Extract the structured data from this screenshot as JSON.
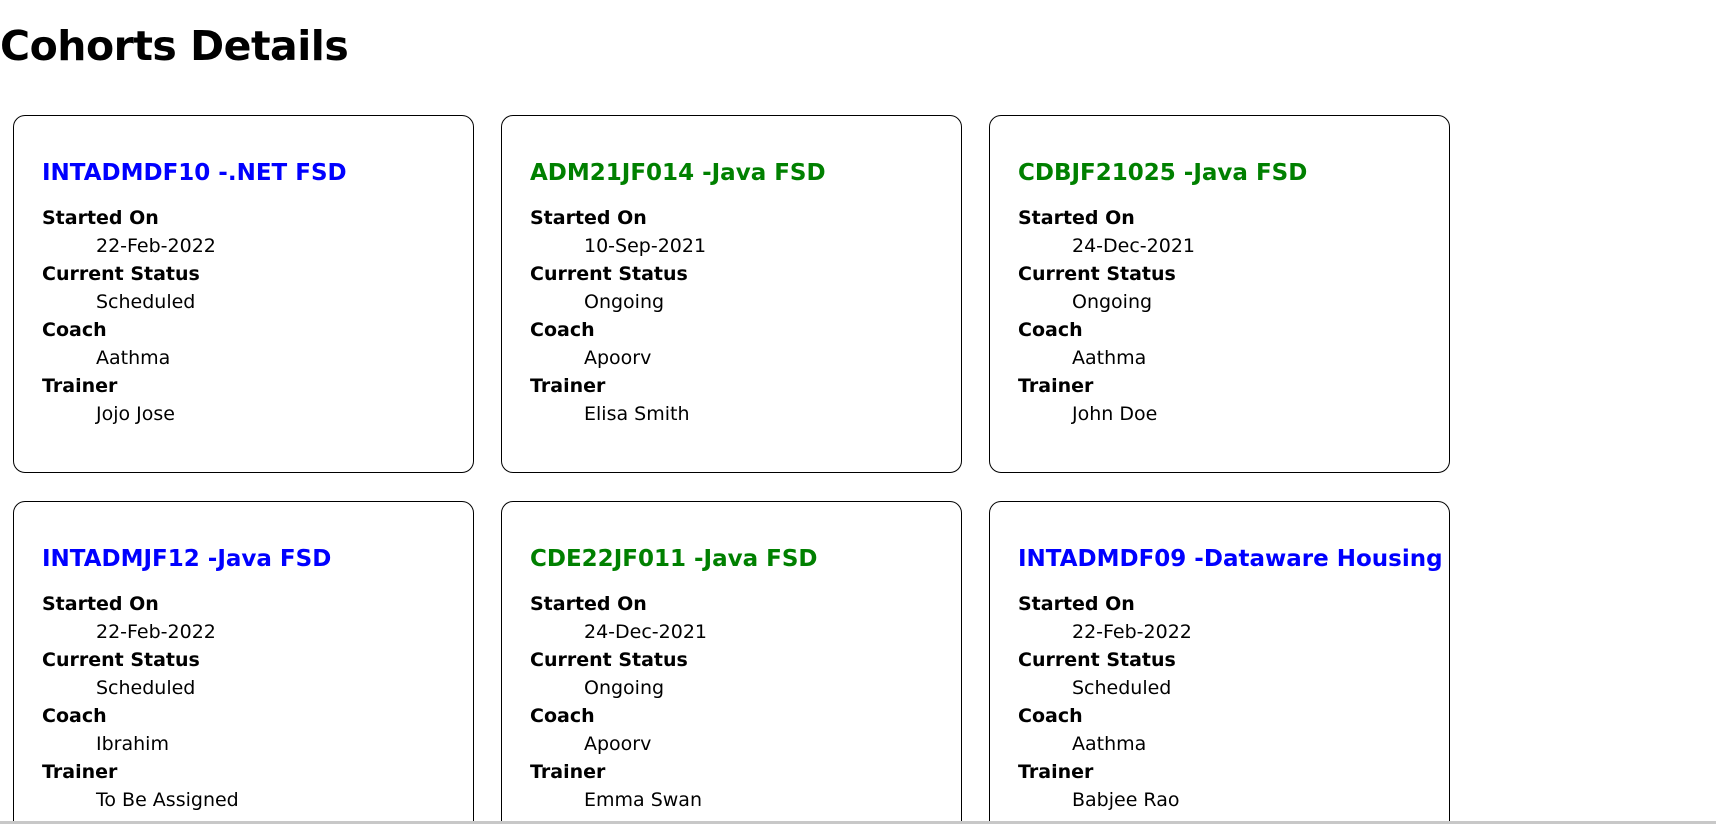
{
  "page": {
    "title": "Cohorts Details"
  },
  "labels": {
    "started_on": "Started On",
    "current_status": "Current Status",
    "coach": "Coach",
    "trainer": "Trainer"
  },
  "colors": {
    "blue_title": "#0000ff",
    "green_title": "#008000"
  },
  "cohorts": [
    {
      "title": "INTADMDF10 -.NET FSD",
      "started_on": "22-Feb-2022",
      "current_status": "Scheduled",
      "coach": "Aathma",
      "trainer": "Jojo Jose",
      "title_color": "blue"
    },
    {
      "title": "ADM21JF014 -Java FSD",
      "started_on": "10-Sep-2021",
      "current_status": "Ongoing",
      "coach": "Apoorv",
      "trainer": "Elisa Smith",
      "title_color": "green"
    },
    {
      "title": "CDBJF21025 -Java FSD",
      "started_on": "24-Dec-2021",
      "current_status": "Ongoing",
      "coach": "Aathma",
      "trainer": "John Doe",
      "title_color": "green"
    },
    {
      "title": "INTADMJF12 -Java FSD",
      "started_on": "22-Feb-2022",
      "current_status": "Scheduled",
      "coach": "Ibrahim",
      "trainer": "To Be Assigned",
      "title_color": "blue"
    },
    {
      "title": "CDE22JF011 -Java FSD",
      "started_on": "24-Dec-2021",
      "current_status": "Ongoing",
      "coach": "Apoorv",
      "trainer": "Emma Swan",
      "title_color": "green"
    },
    {
      "title": "INTADMDF09 -Dataware Housing",
      "started_on": "22-Feb-2022",
      "current_status": "Scheduled",
      "coach": "Aathma",
      "trainer": "Babjee Rao",
      "title_color": "blue"
    }
  ]
}
